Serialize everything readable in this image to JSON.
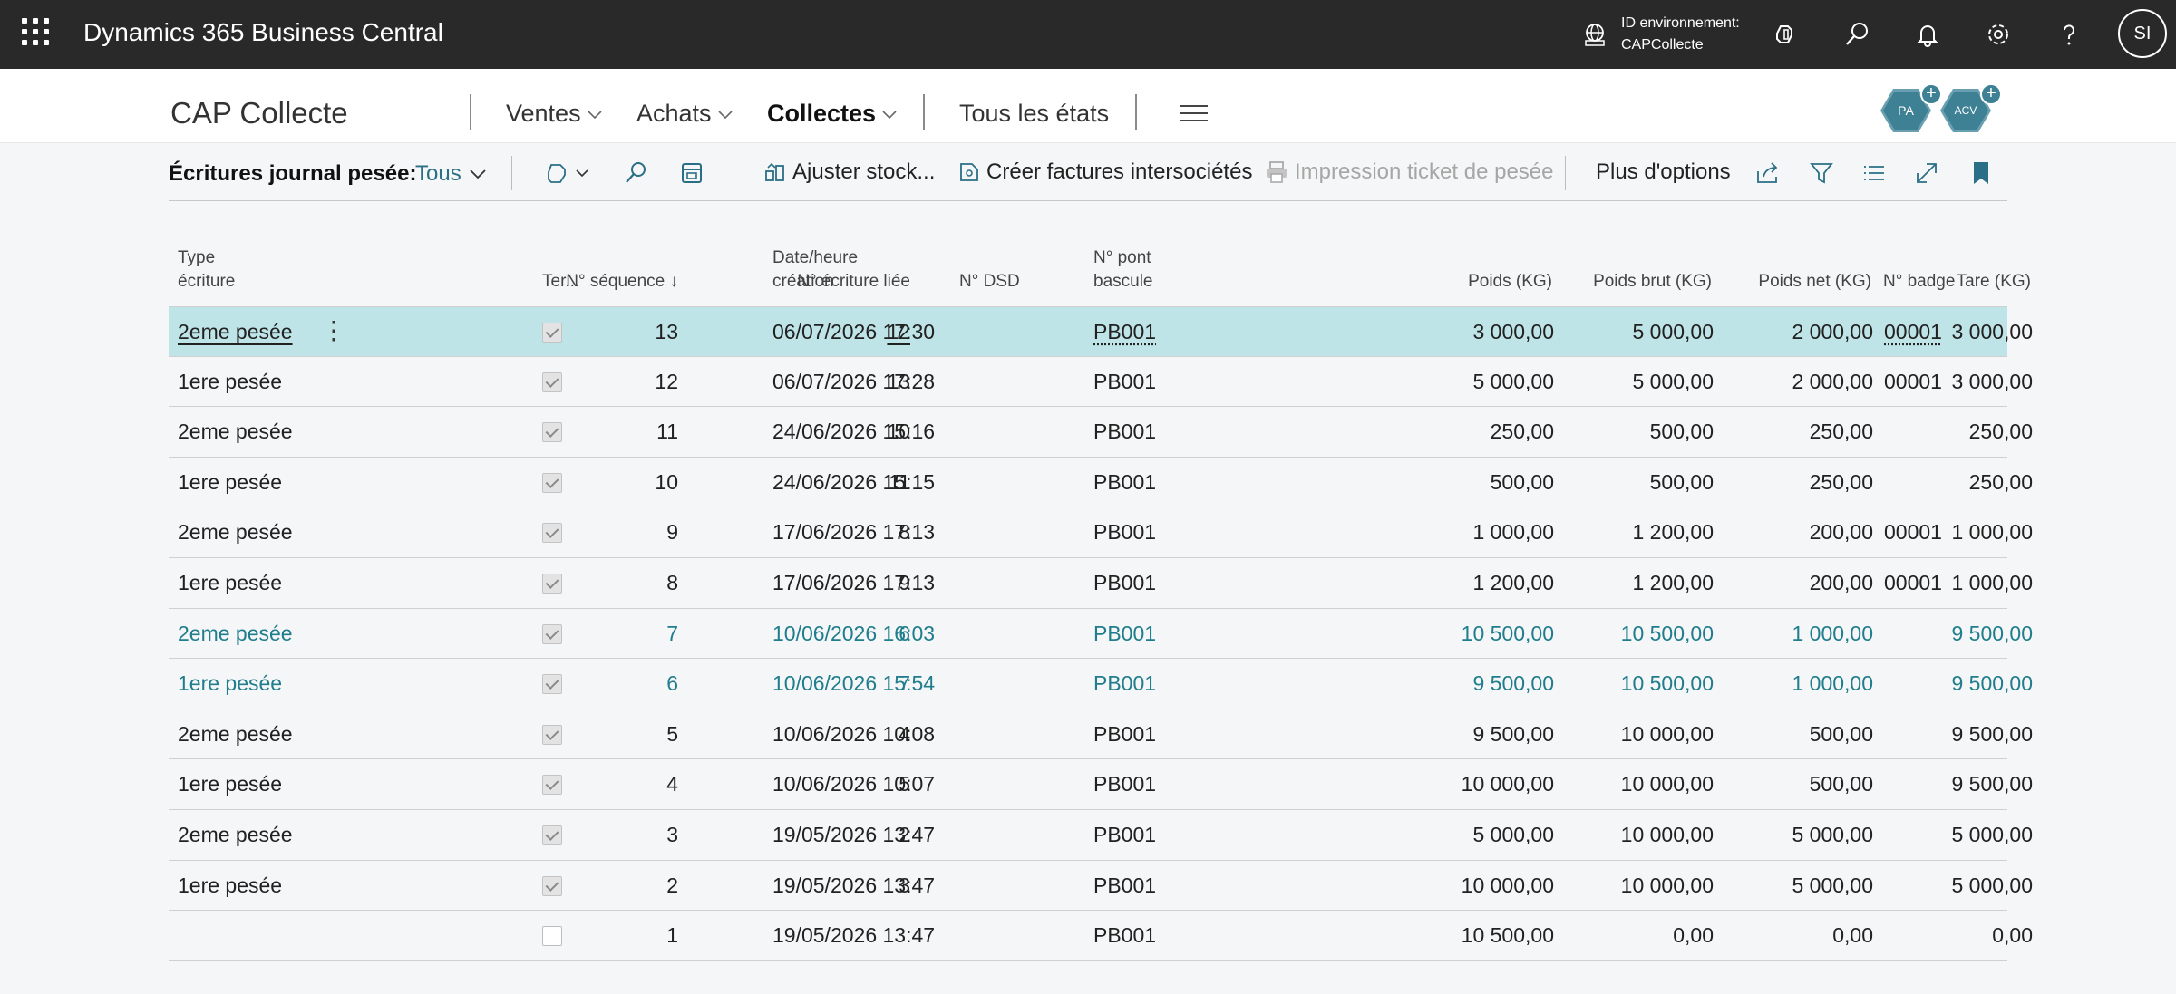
{
  "topbar": {
    "app_title": "Dynamics 365 Business Central",
    "env_label": "ID environnement:",
    "env_value": "CAPCollecte",
    "user_initials": "SI",
    "bg_color": "#292929"
  },
  "nav": {
    "company": "CAP Collecte",
    "items": [
      {
        "label": "Ventes",
        "has_dropdown": true
      },
      {
        "label": "Achats",
        "has_dropdown": true
      },
      {
        "label": "Collectes",
        "has_dropdown": true,
        "active": true
      },
      {
        "label": "Tous les états",
        "has_dropdown": false
      }
    ],
    "badges": [
      "PA",
      "ACV"
    ]
  },
  "action_bar": {
    "title": "Écritures journal pesée:",
    "filter": "Tous",
    "adjust_stock": "Ajuster stock...",
    "create_invoices": "Créer factures intersociétés",
    "print_ticket": "Impression ticket de pesée",
    "more_options": "Plus d'options"
  },
  "table": {
    "headers": {
      "type_l1": "Type",
      "type_l2": "écriture",
      "seq": "N° séquence ↓",
      "ter": "Ter...",
      "linked": "N° écriture liée",
      "date_l1": "Date/heure",
      "date_l2": "création",
      "dsd": "N° DSD",
      "pont_l1": "N° pont",
      "pont_l2": "bascule",
      "poids": "Poids (KG)",
      "brut": "Poids brut (KG)",
      "net": "Poids net (KG)",
      "tare": "Tare (KG)",
      "badge": "N° badge"
    },
    "rows": [
      {
        "type": "2eme pesée",
        "seq": "13",
        "ter": true,
        "linked": "12",
        "date": "06/07/2026 17:30",
        "dsd": "",
        "pont": "PB001",
        "poids": "3 000,00",
        "brut": "5 000,00",
        "net": "2 000,00",
        "tare": "3 000,00",
        "badge": "00001",
        "selected": true,
        "teal": false
      },
      {
        "type": "1ere pesée",
        "seq": "12",
        "ter": true,
        "linked": "13",
        "date": "06/07/2026 17:28",
        "dsd": "",
        "pont": "PB001",
        "poids": "5 000,00",
        "brut": "5 000,00",
        "net": "2 000,00",
        "tare": "3 000,00",
        "badge": "00001",
        "selected": false,
        "teal": false
      },
      {
        "type": "2eme pesée",
        "seq": "11",
        "ter": true,
        "linked": "10",
        "date": "24/06/2026 15:16",
        "dsd": "",
        "pont": "PB001",
        "poids": "250,00",
        "brut": "500,00",
        "net": "250,00",
        "tare": "250,00",
        "badge": "",
        "selected": false,
        "teal": false
      },
      {
        "type": "1ere pesée",
        "seq": "10",
        "ter": true,
        "linked": "11",
        "date": "24/06/2026 15:15",
        "dsd": "",
        "pont": "PB001",
        "poids": "500,00",
        "brut": "500,00",
        "net": "250,00",
        "tare": "250,00",
        "badge": "",
        "selected": false,
        "teal": false
      },
      {
        "type": "2eme pesée",
        "seq": "9",
        "ter": true,
        "linked": "8",
        "date": "17/06/2026 17:13",
        "dsd": "",
        "pont": "PB001",
        "poids": "1 000,00",
        "brut": "1 200,00",
        "net": "200,00",
        "tare": "1 000,00",
        "badge": "00001",
        "selected": false,
        "teal": false
      },
      {
        "type": "1ere pesée",
        "seq": "8",
        "ter": true,
        "linked": "9",
        "date": "17/06/2026 17:13",
        "dsd": "",
        "pont": "PB001",
        "poids": "1 200,00",
        "brut": "1 200,00",
        "net": "200,00",
        "tare": "1 000,00",
        "badge": "00001",
        "selected": false,
        "teal": false
      },
      {
        "type": "2eme pesée",
        "seq": "7",
        "ter": true,
        "linked": "6",
        "date": "10/06/2026 16:03",
        "dsd": "",
        "pont": "PB001",
        "poids": "10 500,00",
        "brut": "10 500,00",
        "net": "1 000,00",
        "tare": "9 500,00",
        "badge": "",
        "selected": false,
        "teal": true
      },
      {
        "type": "1ere pesée",
        "seq": "6",
        "ter": true,
        "linked": "7",
        "date": "10/06/2026 15:54",
        "dsd": "",
        "pont": "PB001",
        "poids": "9 500,00",
        "brut": "10 500,00",
        "net": "1 000,00",
        "tare": "9 500,00",
        "badge": "",
        "selected": false,
        "teal": true
      },
      {
        "type": "2eme pesée",
        "seq": "5",
        "ter": true,
        "linked": "4",
        "date": "10/06/2026 10:08",
        "dsd": "",
        "pont": "PB001",
        "poids": "9 500,00",
        "brut": "10 000,00",
        "net": "500,00",
        "tare": "9 500,00",
        "badge": "",
        "selected": false,
        "teal": false
      },
      {
        "type": "1ere pesée",
        "seq": "4",
        "ter": true,
        "linked": "5",
        "date": "10/06/2026 10:07",
        "dsd": "",
        "pont": "PB001",
        "poids": "10 000,00",
        "brut": "10 000,00",
        "net": "500,00",
        "tare": "9 500,00",
        "badge": "",
        "selected": false,
        "teal": false
      },
      {
        "type": "2eme pesée",
        "seq": "3",
        "ter": true,
        "linked": "2",
        "date": "19/05/2026 13:47",
        "dsd": "",
        "pont": "PB001",
        "poids": "5 000,00",
        "brut": "10 000,00",
        "net": "5 000,00",
        "tare": "5 000,00",
        "badge": "",
        "selected": false,
        "teal": false
      },
      {
        "type": "1ere pesée",
        "seq": "2",
        "ter": true,
        "linked": "3",
        "date": "19/05/2026 13:47",
        "dsd": "",
        "pont": "PB001",
        "poids": "10 000,00",
        "brut": "10 000,00",
        "net": "5 000,00",
        "tare": "5 000,00",
        "badge": "",
        "selected": false,
        "teal": false
      },
      {
        "type": "",
        "seq": "1",
        "ter": false,
        "linked": "",
        "date": "19/05/2026 13:47",
        "dsd": "",
        "pont": "PB001",
        "poids": "10 500,00",
        "brut": "0,00",
        "net": "0,00",
        "tare": "0,00",
        "badge": "",
        "selected": false,
        "teal": false
      }
    ]
  },
  "colors": {
    "accent": "#2b6f86",
    "teal_row_text": "#1f7d8c",
    "selected_row": "#bfe4e8"
  }
}
